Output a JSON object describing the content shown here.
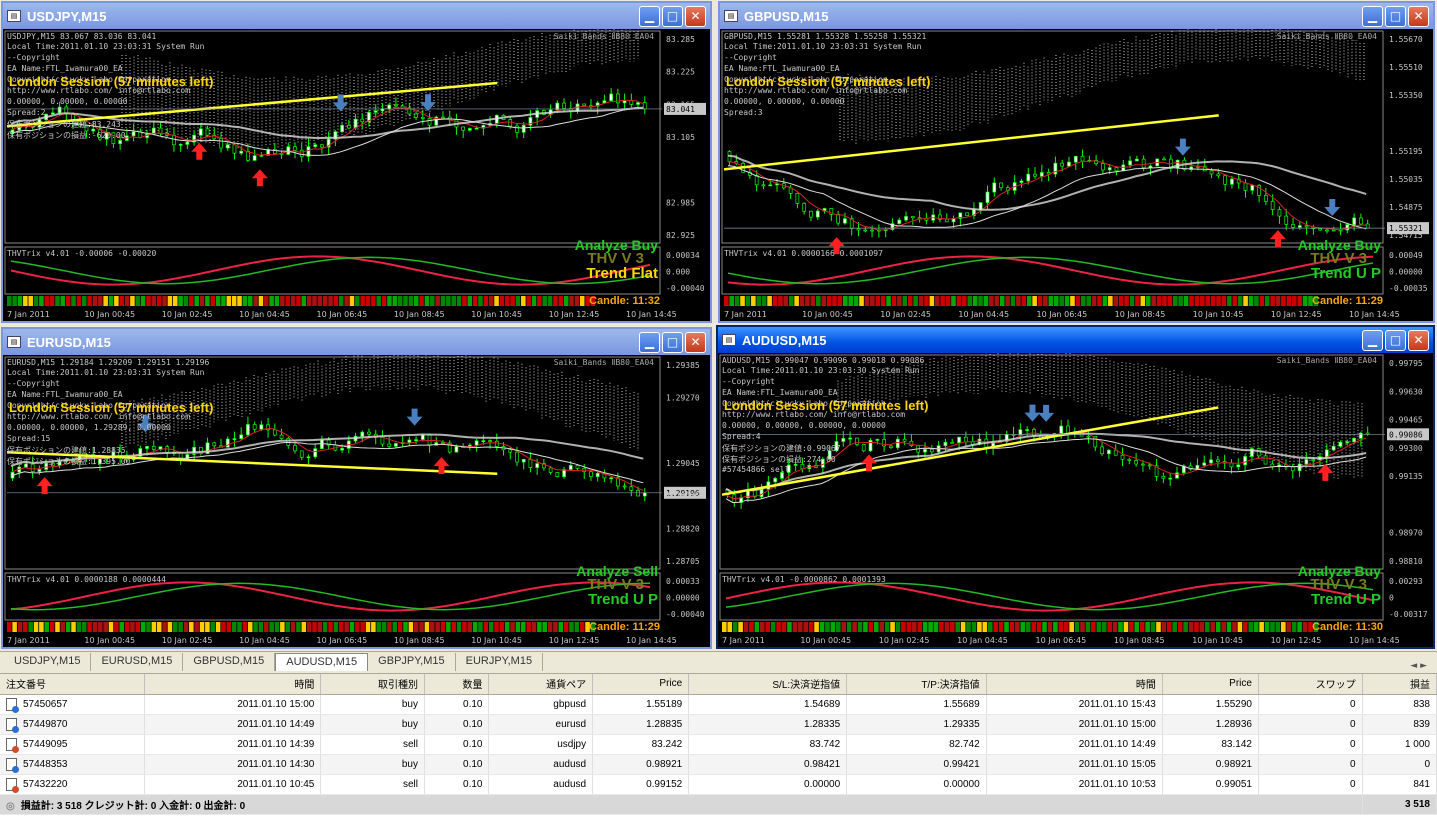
{
  "windows": [
    {
      "title": "USDJPY,M15",
      "header": "USDJPY,M15  83.067 83.036 83.041",
      "localtime": "Local Time:2011.01.10 23:03:31 System Run",
      "lines": [
        "--Copyright",
        "EA Name:FTL_Iwamura00_EA",
        "Copyright(c)Lucky Labo Corporation",
        "http://www.rtlabo.com/ info@rtlabo.com",
        "0.00000, 0.00000, 0.00000",
        "Spread:2",
        "保有ポジションの建値:83.243",
        "保有ポジションの損益:-620.00"
      ],
      "session": "London Session (57 minutes left)",
      "symbol_tag": "Saiki_Bands ⅡB80_EA04",
      "price_ticks": [
        "83.285",
        "83.225",
        "83.165",
        "83.105",
        "83.041",
        "82.985",
        "82.925"
      ],
      "current_price": "83.041",
      "analyze": "Analyze Buy",
      "thv": "THV V 3",
      "trend": "Trend Flat",
      "trend_up": false,
      "trix": "THVTrix v4.01 -0.00006 -0.00020",
      "sub_ticks": [
        "0.00034",
        "0.000",
        "-0.00040"
      ],
      "candle": "Candle:  11:32",
      "time_ticks": [
        "7 Jan 2011",
        "10 Jan 00:45",
        "10 Jan 02:45",
        "10 Jan 04:45",
        "10 Jan 06:45",
        "10 Jan 08:45",
        "10 Jan 10:45",
        "10 Jan 12:45",
        "10 Jan 14:45"
      ],
      "active": false
    },
    {
      "title": "GBPUSD,M15",
      "header": "GBPUSD,M15  1.55281 1.55328 1.55258 1.55321",
      "localtime": "Local Time:2011.01.10 23:03:31 System Run",
      "lines": [
        "--Copyright",
        "EA Name:FTL_Iwamura00_EA",
        "Copyright(c)Lucky Labo Corporation",
        "http://www.rtlabo.com/ info@rtlabo.com",
        "0.00000, 0.00000, 0.00000",
        "Spread:3"
      ],
      "session": "London Session (57 minutes left)",
      "symbol_tag": "Saiki_Bands ⅡB80_EA04",
      "price_ticks": [
        "1.55670",
        "1.55510",
        "1.55350",
        "1.55321",
        "1.55195",
        "1.55035",
        "1.54875",
        "1.54715"
      ],
      "current_price": "1.55321",
      "analyze": "Analyze Buy",
      "thv": "THV V 3",
      "trend": "Trend U P",
      "trend_up": true,
      "trix": "THVTrix v4.01 0.0000166 0.0001097",
      "sub_ticks": [
        "0.00049",
        "0.00000",
        "-0.00035"
      ],
      "candle": "Candle:  11:29",
      "time_ticks": [
        "7 Jan 2011",
        "10 Jan 00:45",
        "10 Jan 02:45",
        "10 Jan 04:45",
        "10 Jan 06:45",
        "10 Jan 08:45",
        "10 Jan 10:45",
        "10 Jan 12:45",
        "10 Jan 14:45"
      ],
      "active": false
    },
    {
      "title": "EURUSD,M15",
      "header": "EURUSD,M15  1.29184 1.29209 1.29151 1.29196",
      "localtime": "Local Time:2011.01.10 23:03:31 System Run",
      "lines": [
        "--Copyright",
        "EA Name:FTL_Iwamura00_EA",
        "Copyright(c)Lucky Labo Corporation",
        "http://www.rtlabo.com/ info@rtlabo.com",
        "0.00000, 0.00000, 1.29289, 0.00000",
        "Spread:15",
        "保有ポジションの建値:1.28835",
        "保有ポジションの損益:1,395.00"
      ],
      "session": "London Session (57 minutes left)",
      "symbol_tag": "Saiki_Bands ⅡB80_EA04",
      "price_ticks": [
        "1.29385",
        "1.29270",
        "1.29196",
        "1.29045",
        "1.28935",
        "1.28820",
        "1.28705"
      ],
      "current_price": "1.29196",
      "analyze": "Analyze Sell",
      "thv": "THV V 3",
      "trend": "Trend U P",
      "trend_up": true,
      "trix": "THVTrix v4.01 0.0000188 0.0000444",
      "sub_ticks": [
        "0.00033",
        "0.00000",
        "-0.00040"
      ],
      "candle": "Candle:  11:29",
      "time_ticks": [
        "7 Jan 2011",
        "10 Jan 00:45",
        "10 Jan 02:45",
        "10 Jan 04:45",
        "10 Jan 06:45",
        "10 Jan 08:45",
        "10 Jan 10:45",
        "10 Jan 12:45",
        "10 Jan 14:45"
      ],
      "active": false
    },
    {
      "title": "AUDUSD,M15",
      "header": "AUDUSD,M15  0.99047 0.99096 0.99018 0.99086",
      "localtime": "Local Time:2011.01.10 23:03:30 System Run",
      "lines": [
        "--Copyright",
        "EA Name:FTL_Iwamura00_EA",
        "Copyright(c)Lucky Labo Corporation",
        "http://www.rtlabo.com/ info@rtlabo.com",
        "0.00000, 0.00000, 0.00000, 0.00000",
        "Spread:4",
        "保有ポジションの建値:0.99067",
        "保有ポジションの損益:274.00",
        "#57454866 sell"
      ],
      "session": "London Session (57 minutes left)",
      "symbol_tag": "Saiki_Bands ⅡB80_EA04",
      "price_ticks": [
        "0.99795",
        "0.99630",
        "0.99465",
        "0.99300",
        "0.99135",
        "0.99086",
        "0.98970",
        "0.98810"
      ],
      "current_price": "0.99086",
      "analyze": "Analyze Buy",
      "thv": "THV V 3",
      "trend": "Trend U P",
      "trend_up": true,
      "trix": "THVTrix v4.01 -0.0000862 0.0001393",
      "sub_ticks": [
        "0.00293",
        "0",
        "-0.00317"
      ],
      "candle": "Candle:  11:30",
      "time_ticks": [
        "7 Jan 2011",
        "10 Jan 00:45",
        "10 Jan 02:45",
        "10 Jan 04:45",
        "10 Jan 06:45",
        "10 Jan 08:45",
        "10 Jan 10:45",
        "10 Jan 12:45",
        "10 Jan 14:45"
      ],
      "active": true
    }
  ],
  "tabs": [
    "USDJPY,M15",
    "EURUSD,M15",
    "GBPUSD,M15",
    "AUDUSD,M15",
    "GBPJPY,M15",
    "EURJPY,M15"
  ],
  "active_tab": "AUDUSD,M15",
  "tab_nav": "◄ ►",
  "terminal": {
    "headers": [
      "注文番号",
      "時間",
      "取引種別",
      "数量",
      "通貨ペア",
      "Price",
      "S/L:決済逆指値",
      "T/P:決済指値",
      "時間",
      "Price",
      "スワップ",
      "損益"
    ],
    "rows": [
      [
        "57450657",
        "2011.01.10 15:00",
        "buy",
        "0.10",
        "gbpusd",
        "1.55189",
        "1.54689",
        "1.55689",
        "2011.01.10 15:43",
        "1.55290",
        "0",
        "838"
      ],
      [
        "57449870",
        "2011.01.10 14:49",
        "buy",
        "0.10",
        "eurusd",
        "1.28835",
        "1.28335",
        "1.29335",
        "2011.01.10 15:00",
        "1.28936",
        "0",
        "839"
      ],
      [
        "57449095",
        "2011.01.10 14:39",
        "sell",
        "0.10",
        "usdjpy",
        "83.242",
        "83.742",
        "82.742",
        "2011.01.10 14:49",
        "83.142",
        "0",
        "1 000"
      ],
      [
        "57448353",
        "2011.01.10 14:30",
        "buy",
        "0.10",
        "audusd",
        "0.98921",
        "0.98421",
        "0.99421",
        "2011.01.10 15:05",
        "0.98921",
        "0",
        "0"
      ],
      [
        "57432220",
        "2011.01.10 10:45",
        "sell",
        "0.10",
        "audusd",
        "0.99152",
        "0.00000",
        "0.00000",
        "2011.01.10 10:53",
        "0.99051",
        "0",
        "841"
      ]
    ],
    "summary": "損益計: 3 518  クレジット計: 0  入金計: 0  出金計: 0",
    "total": "3 518"
  },
  "colors": {
    "candle_up": "#00ff00",
    "candle_body_up": "#ffffff",
    "ma_yellow": "#ffff33",
    "ma_white": "#dddddd",
    "ma_red": "#dd2222",
    "arrow_up_red": "#ff2020",
    "arrow_down_blue": "#4a7fc0"
  }
}
